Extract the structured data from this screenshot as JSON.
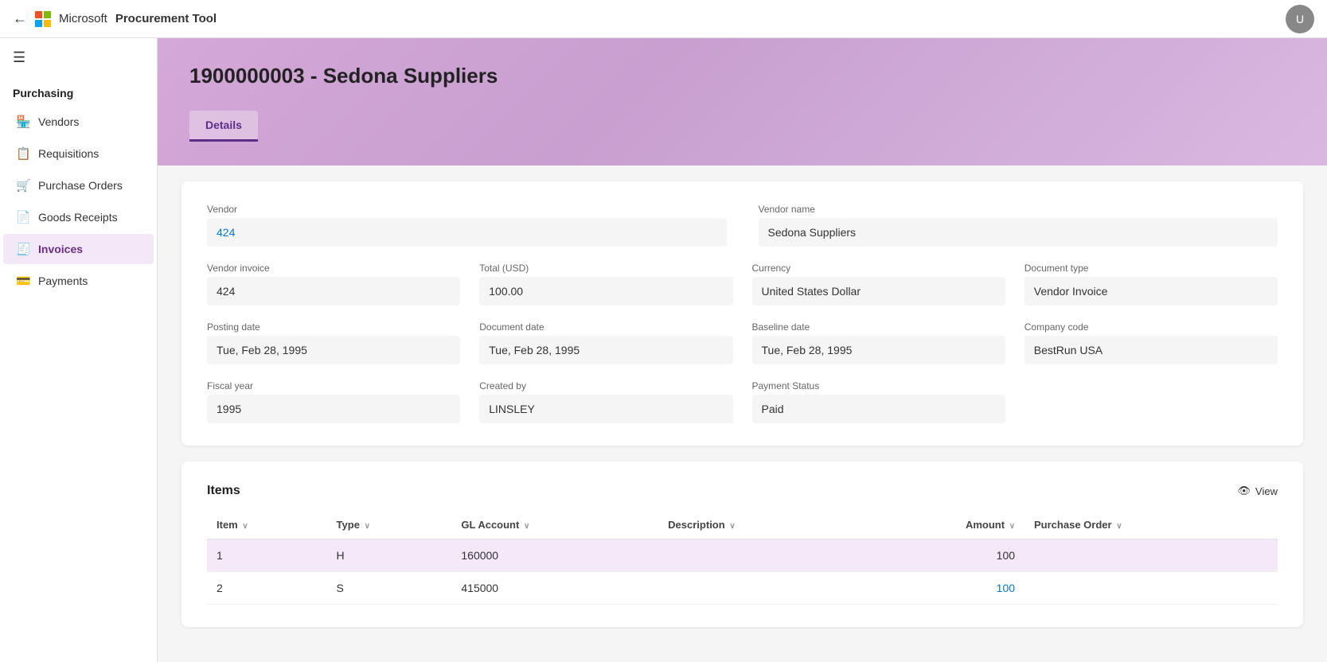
{
  "topbar": {
    "brand": "Microsoft",
    "app_title": "Procurement Tool",
    "back_icon": "←",
    "avatar_initials": "U"
  },
  "sidebar": {
    "hamburger": "☰",
    "section_label": "Purchasing",
    "items": [
      {
        "id": "vendors",
        "label": "Vendors",
        "icon": "🏪",
        "active": false
      },
      {
        "id": "requisitions",
        "label": "Requisitions",
        "icon": "📋",
        "active": false
      },
      {
        "id": "purchase-orders",
        "label": "Purchase Orders",
        "icon": "🛒",
        "active": false
      },
      {
        "id": "goods-receipts",
        "label": "Goods Receipts",
        "icon": "📄",
        "active": false
      },
      {
        "id": "invoices",
        "label": "Invoices",
        "icon": "🧾",
        "active": true
      },
      {
        "id": "payments",
        "label": "Payments",
        "icon": "💳",
        "active": false
      }
    ]
  },
  "page": {
    "title": "1900000003 - Sedona Suppliers",
    "tabs": [
      {
        "id": "details",
        "label": "Details",
        "active": true
      }
    ]
  },
  "details": {
    "vendor_label": "Vendor",
    "vendor_value": "424",
    "vendor_name_label": "Vendor name",
    "vendor_name_value": "Sedona Suppliers",
    "vendor_invoice_label": "Vendor invoice",
    "vendor_invoice_value": "424",
    "total_usd_label": "Total (USD)",
    "total_usd_value": "100.00",
    "currency_label": "Currency",
    "currency_value": "United States Dollar",
    "document_type_label": "Document type",
    "document_type_value": "Vendor Invoice",
    "posting_date_label": "Posting date",
    "posting_date_value": "Tue, Feb 28, 1995",
    "document_date_label": "Document date",
    "document_date_value": "Tue, Feb 28, 1995",
    "baseline_date_label": "Baseline date",
    "baseline_date_value": "Tue, Feb 28, 1995",
    "company_code_label": "Company code",
    "company_code_value": "BestRun USA",
    "fiscal_year_label": "Fiscal year",
    "fiscal_year_value": "1995",
    "created_by_label": "Created by",
    "created_by_value": "LINSLEY",
    "payment_status_label": "Payment Status",
    "payment_status_value": "Paid"
  },
  "items_section": {
    "title": "Items",
    "view_label": "View",
    "view_icon": "👁",
    "columns": [
      {
        "id": "item",
        "label": "Item",
        "sortable": true
      },
      {
        "id": "type",
        "label": "Type",
        "sortable": true
      },
      {
        "id": "gl_account",
        "label": "GL Account",
        "sortable": true
      },
      {
        "id": "description",
        "label": "Description",
        "sortable": true
      },
      {
        "id": "amount",
        "label": "Amount",
        "sortable": true
      },
      {
        "id": "purchase_order",
        "label": "Purchase Order",
        "sortable": true
      }
    ],
    "rows": [
      {
        "item": "1",
        "type": "H",
        "gl_account": "160000",
        "description": "",
        "amount": "100",
        "purchase_order": "",
        "highlighted": true,
        "amount_link": false
      },
      {
        "item": "2",
        "type": "S",
        "gl_account": "415000",
        "description": "",
        "amount": "100",
        "purchase_order": "",
        "highlighted": false,
        "amount_link": true
      }
    ]
  }
}
